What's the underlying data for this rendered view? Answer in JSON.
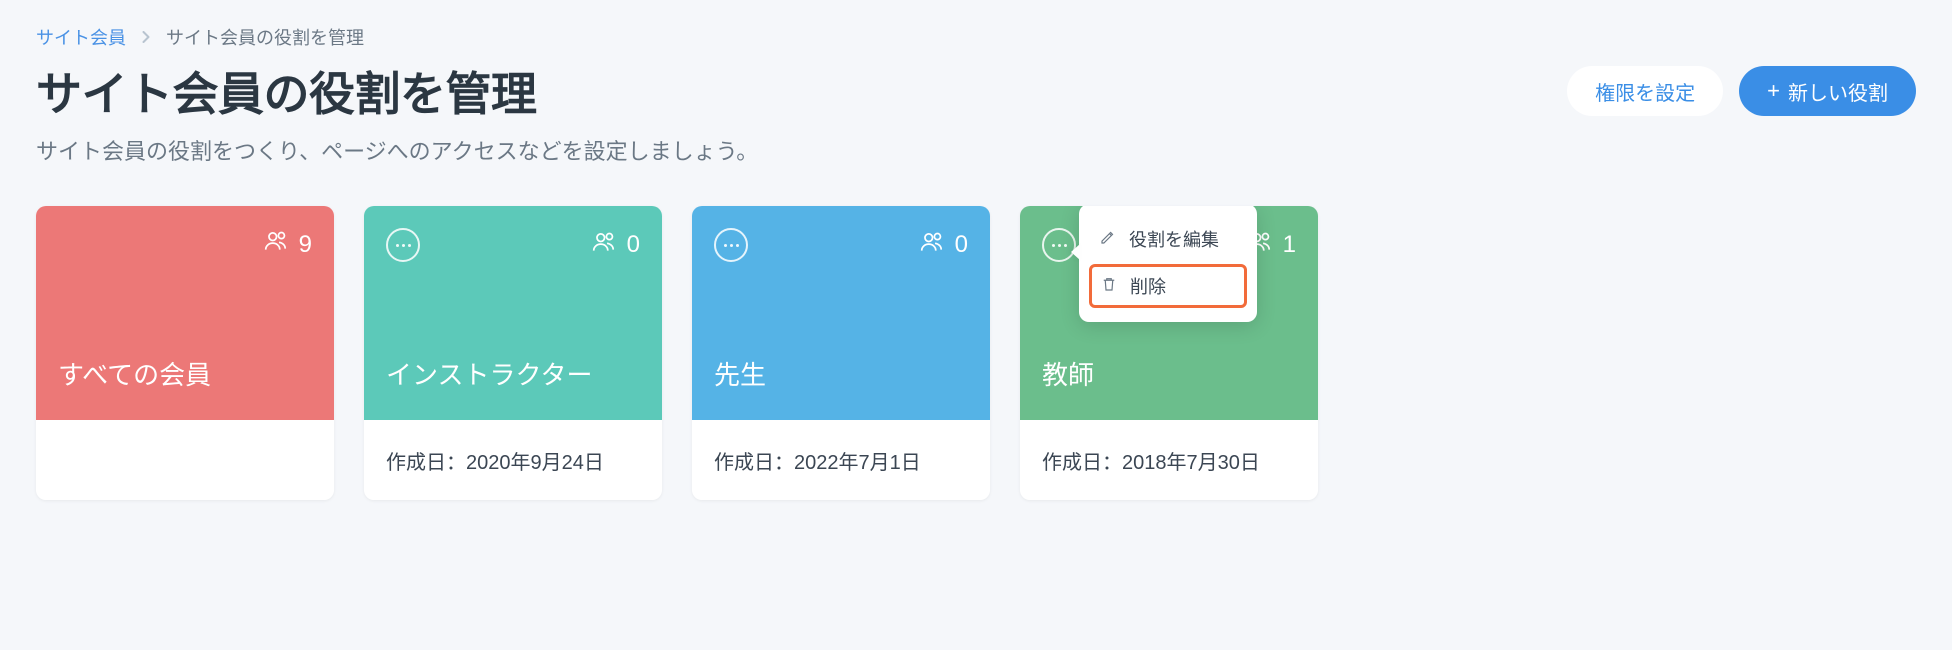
{
  "breadcrumb": {
    "root": "サイト会員",
    "current": "サイト会員の役割を管理"
  },
  "page": {
    "title": "サイト会員の役割を管理",
    "subtitle": "サイト会員の役割をつくり、ページへのアクセスなどを設定しましょう。"
  },
  "buttons": {
    "set_permissions": "権限を設定",
    "new_role": "新しい役割"
  },
  "popover": {
    "edit": "役割を編集",
    "delete": "削除"
  },
  "cards": [
    {
      "title": "すべての会員",
      "count": "9",
      "created_label": "",
      "show_more": false
    },
    {
      "title": "インストラクター",
      "count": "0",
      "created_label": "作成日：2020年9月24日",
      "show_more": true
    },
    {
      "title": "先生",
      "count": "0",
      "created_label": "作成日：2022年7月1日",
      "show_more": true
    },
    {
      "title": "教師",
      "count": "1",
      "created_label": "作成日：2018年7月30日",
      "show_more": true
    }
  ]
}
